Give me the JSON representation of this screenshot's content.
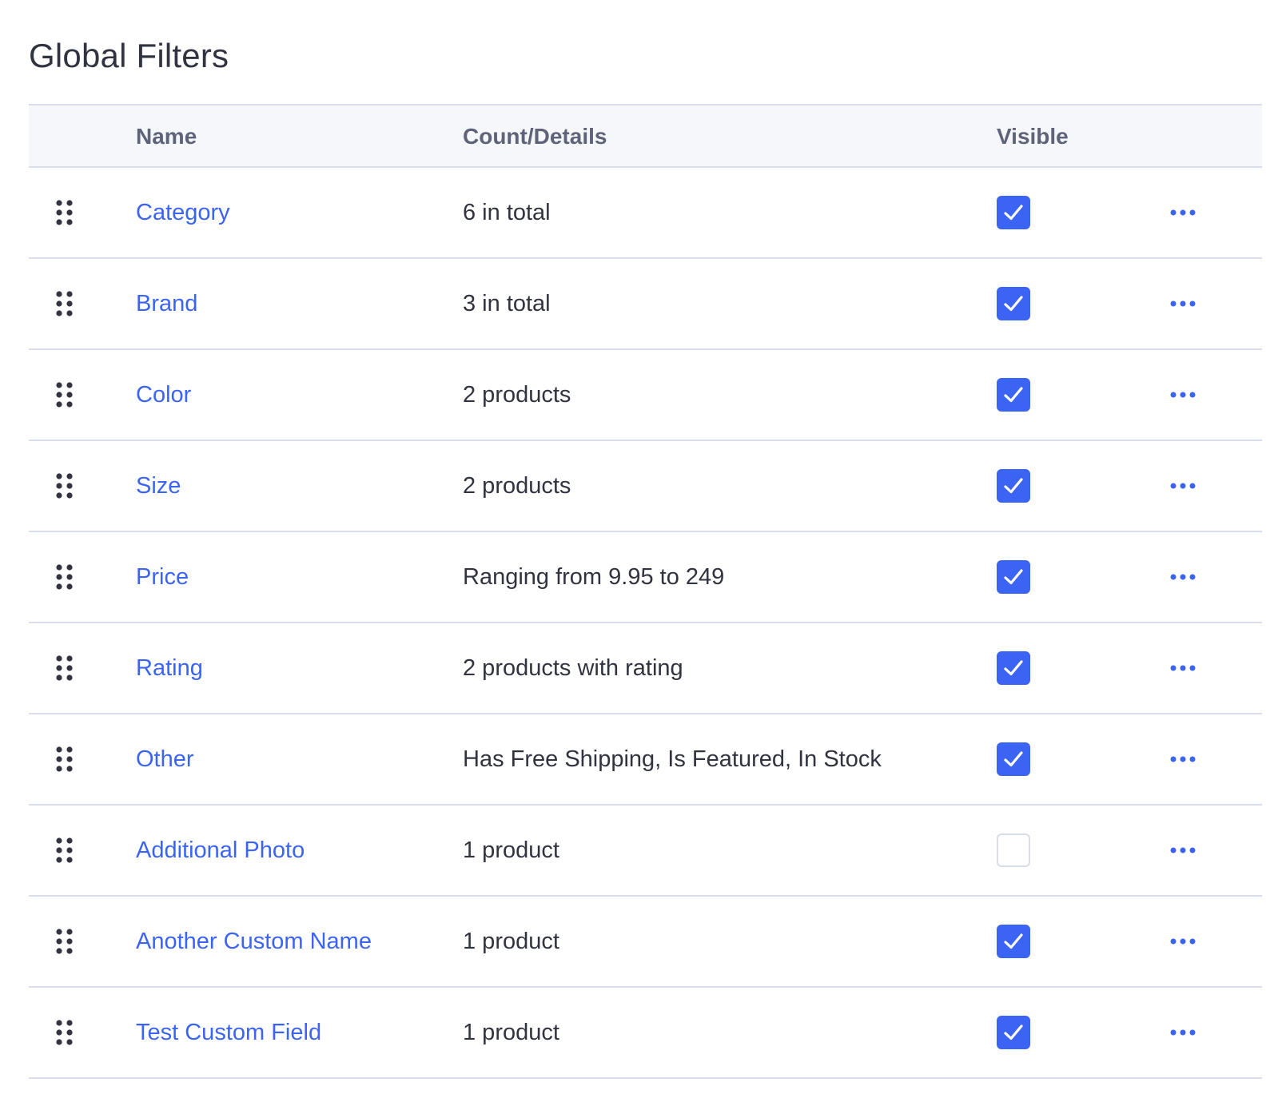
{
  "page": {
    "title": "Global Filters"
  },
  "table": {
    "columns": {
      "name": "Name",
      "count": "Count/Details",
      "visible": "Visible"
    },
    "rows": [
      {
        "name": "Category",
        "details": "6 in total",
        "visible": true
      },
      {
        "name": "Brand",
        "details": "3 in total",
        "visible": true
      },
      {
        "name": "Color",
        "details": "2 products",
        "visible": true
      },
      {
        "name": "Size",
        "details": "2 products",
        "visible": true
      },
      {
        "name": "Price",
        "details": "Ranging from 9.95 to 249",
        "visible": true
      },
      {
        "name": "Rating",
        "details": "2 products with rating",
        "visible": true
      },
      {
        "name": "Other",
        "details": "Has Free Shipping, Is Featured, In Stock",
        "visible": true
      },
      {
        "name": "Additional Photo",
        "details": "1 product",
        "visible": false
      },
      {
        "name": "Another Custom Name",
        "details": "1 product",
        "visible": true
      },
      {
        "name": "Test Custom Field",
        "details": "1 product",
        "visible": true
      }
    ]
  },
  "icons": {
    "drag": "drag-handle-icon",
    "check": "checkmark-icon",
    "more": "more-horizontal-icon"
  },
  "colors": {
    "accent": "#3c64f4",
    "text": "#313440",
    "header_text": "#5e637a",
    "header_bg": "#f5f7fa",
    "border": "#d9dce9"
  }
}
